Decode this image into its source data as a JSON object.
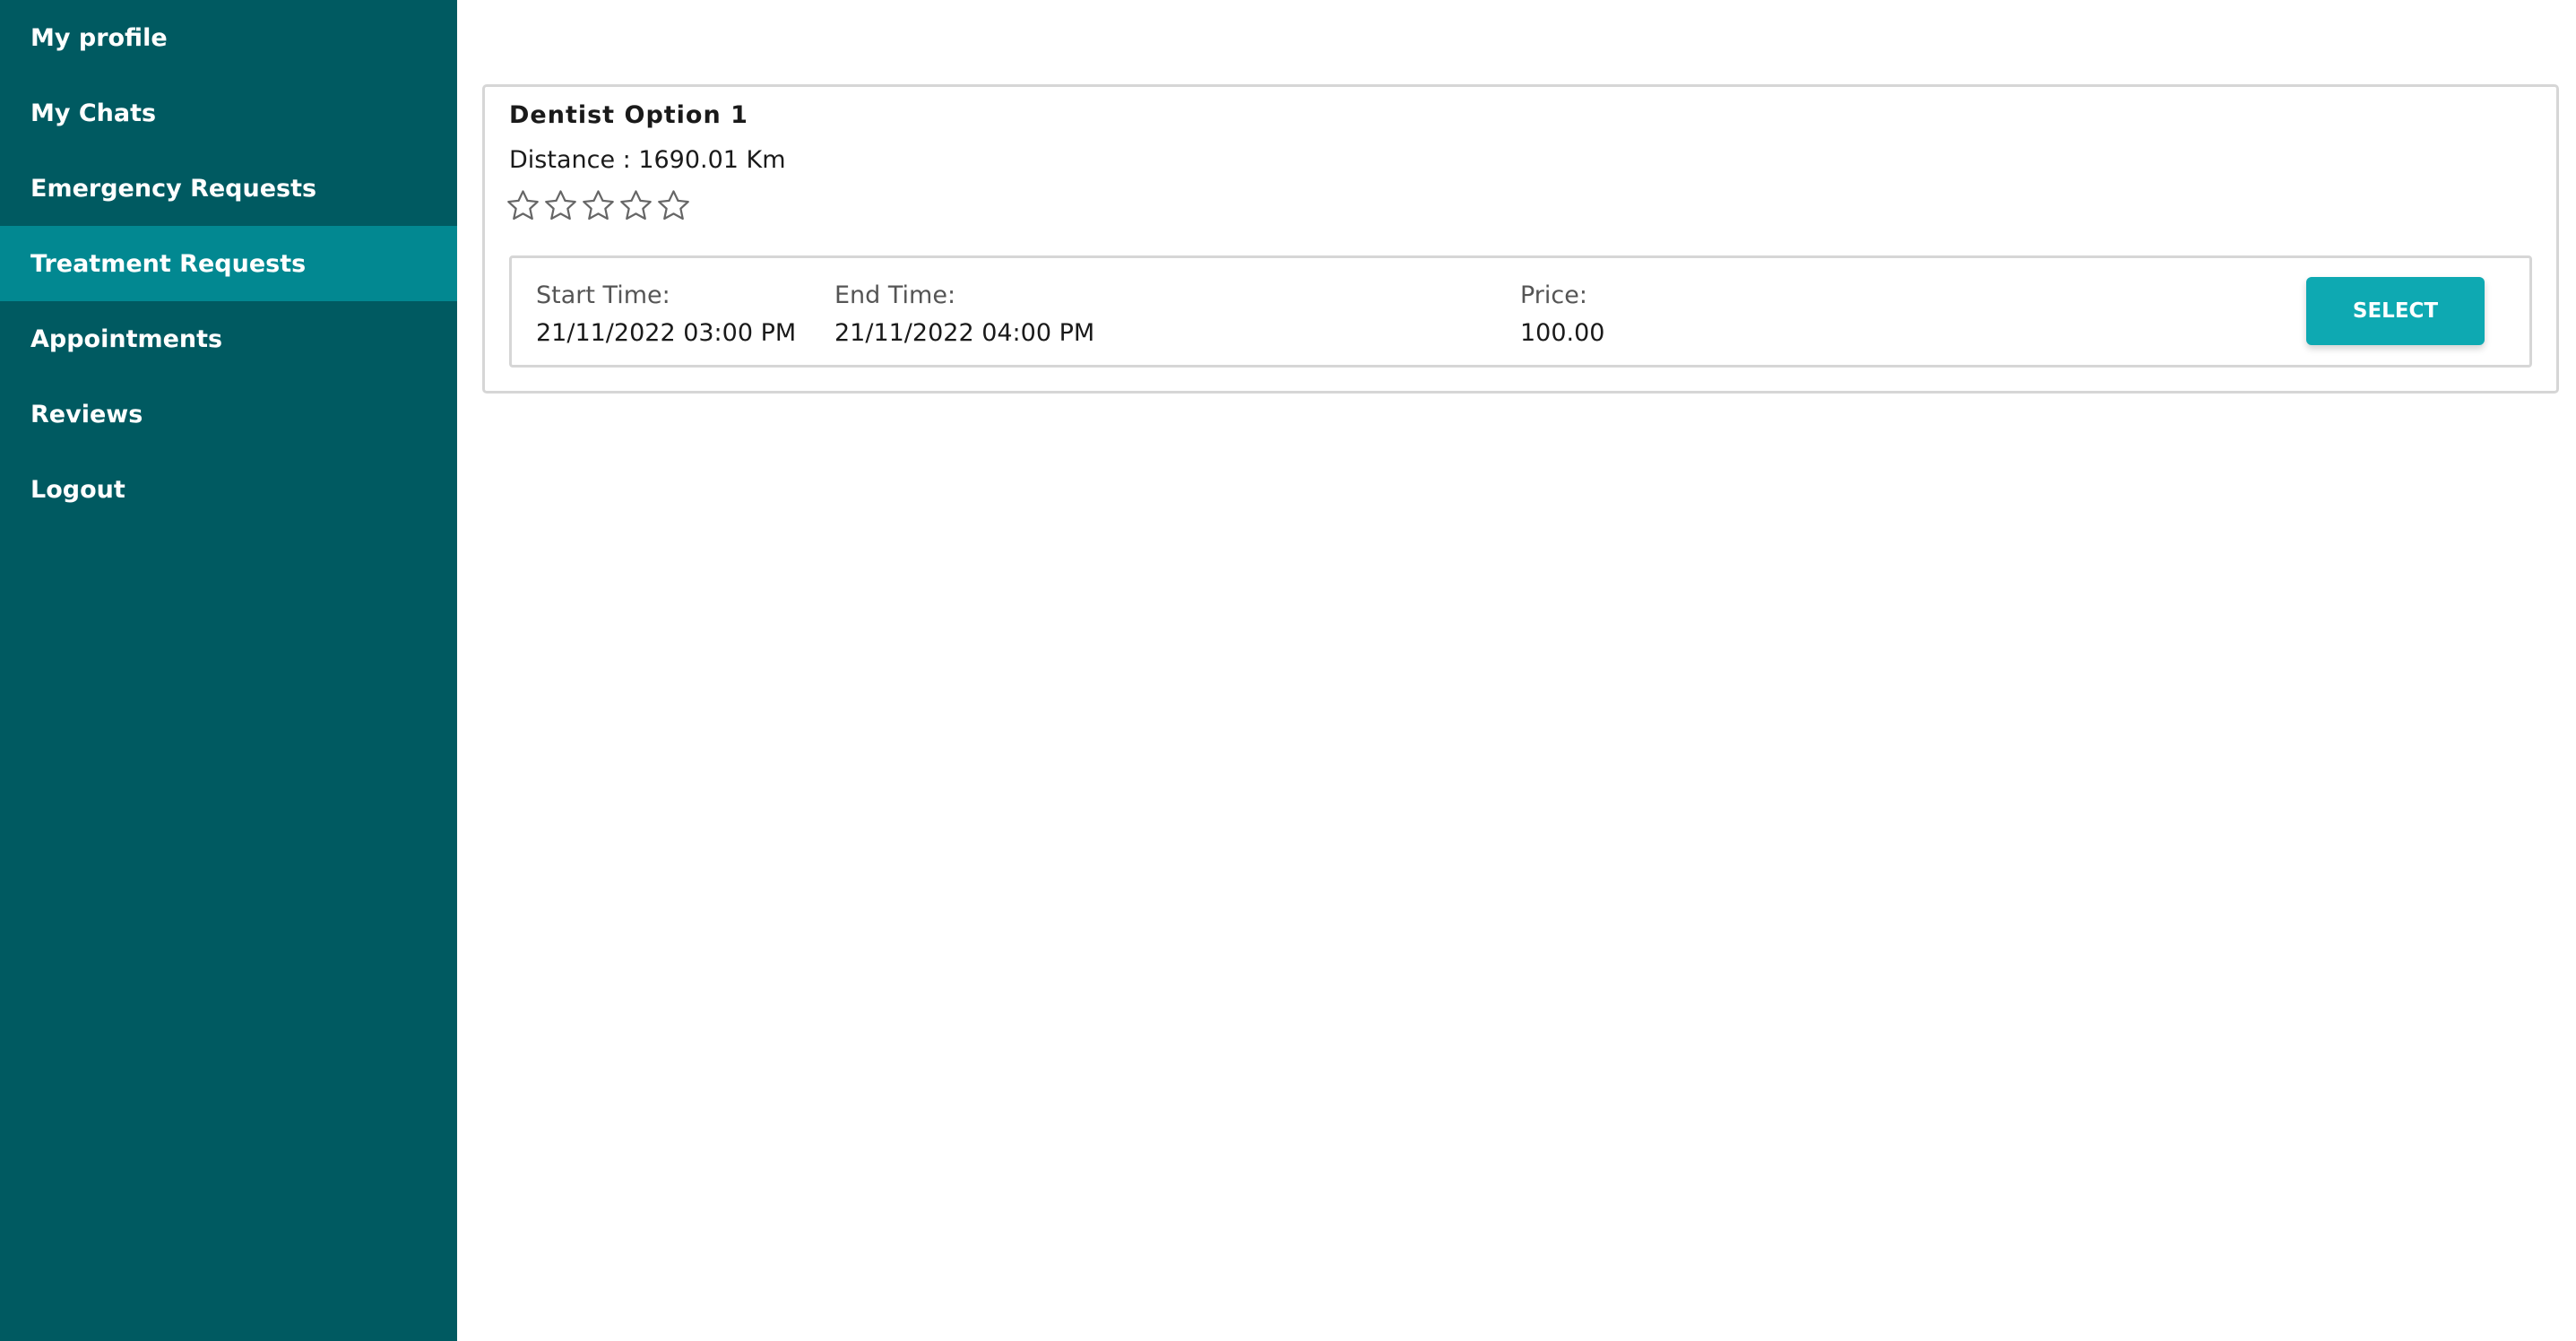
{
  "sidebar": {
    "items": [
      {
        "label": "My profile",
        "active": false
      },
      {
        "label": "My Chats",
        "active": false
      },
      {
        "label": "Emergency Requests",
        "active": false
      },
      {
        "label": "Treatment Requests",
        "active": true
      },
      {
        "label": "Appointments",
        "active": false
      },
      {
        "label": "Reviews",
        "active": false
      },
      {
        "label": "Logout",
        "active": false
      }
    ]
  },
  "option": {
    "title": "Dentist Option 1",
    "distance": "Distance : 1690.01 Km",
    "rating": 0,
    "rating_max": 5,
    "slot": {
      "start_label": "Start Time:",
      "start_value": "21/11/2022 03:00 PM",
      "end_label": "End Time:",
      "end_value": "21/11/2022 04:00 PM",
      "price_label": "Price:",
      "price_value": "100.00",
      "select_label": "SELECT"
    }
  },
  "colors": {
    "sidebar_bg": "#005a61",
    "sidebar_active": "#028891",
    "button_bg": "#0ea9b2",
    "star_outline": "#666666"
  }
}
